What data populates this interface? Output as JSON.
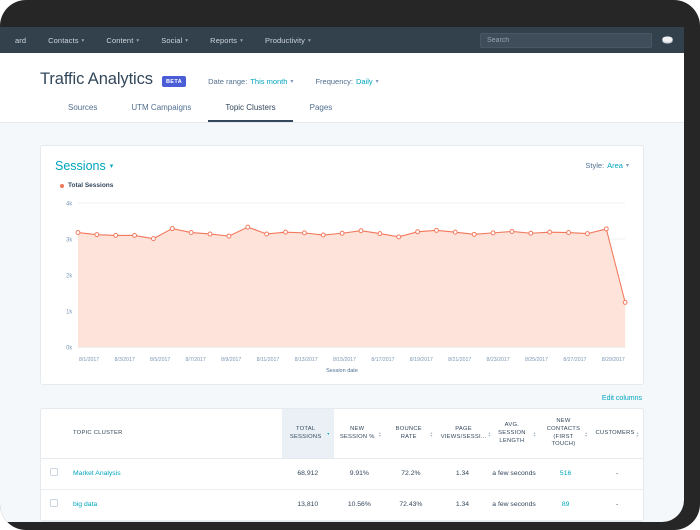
{
  "top_nav": {
    "items": [
      {
        "label": "ard",
        "caret": false
      },
      {
        "label": "Contacts",
        "caret": true
      },
      {
        "label": "Content",
        "caret": true
      },
      {
        "label": "Social",
        "caret": true
      },
      {
        "label": "Reports",
        "caret": true
      },
      {
        "label": "Productivity",
        "caret": true
      }
    ],
    "search_placeholder": "Search",
    "search_value": "",
    "sprocket_icon": "sprocket-icon",
    "background_color": "#33414d"
  },
  "header": {
    "title": "Traffic Analytics",
    "badge": "BETA",
    "badge_color": "#4a5dd7",
    "date_range_label": "Date range:",
    "date_range_value": "This month",
    "frequency_label": "Frequency:",
    "frequency_value": "Daily",
    "accent_color": "#00a4bd"
  },
  "tabs": [
    {
      "label": "Sources",
      "active": false
    },
    {
      "label": "UTM Campaigns",
      "active": false
    },
    {
      "label": "Topic Clusters",
      "active": true
    },
    {
      "label": "Pages",
      "active": false
    }
  ],
  "chart_card": {
    "title": "Sessions",
    "style_label": "Style:",
    "style_value": "Area",
    "legend_label": "Total Sessions",
    "legend_color": "#f2785c"
  },
  "chart_data": {
    "type": "area",
    "title": "Sessions",
    "xlabel": "Session date",
    "ylabel": "",
    "ylim": [
      0,
      4000
    ],
    "ytick_labels": [
      "0k",
      "1k",
      "2k",
      "3k",
      "4k"
    ],
    "ytick_values": [
      0,
      1000,
      2000,
      3000,
      4000
    ],
    "grid": true,
    "legend_position": "top-left",
    "series": [
      {
        "name": "Total Sessions",
        "color": "#f2785c",
        "fill_color": "#fde3da",
        "values": [
          3180,
          3120,
          3100,
          3100,
          3010,
          3290,
          3180,
          3140,
          3080,
          3330,
          3140,
          3190,
          3170,
          3110,
          3160,
          3230,
          3150,
          3060,
          3200,
          3240,
          3190,
          3130,
          3170,
          3210,
          3160,
          3190,
          3180,
          3150,
          3280,
          1240
        ]
      }
    ],
    "x": [
      "8/1/2017",
      "8/2/2017",
      "8/3/2017",
      "8/4/2017",
      "8/5/2017",
      "8/6/2017",
      "8/7/2017",
      "8/8/2017",
      "8/9/2017",
      "8/10/2017",
      "8/11/2017",
      "8/12/2017",
      "8/13/2017",
      "8/14/2017",
      "8/15/2017",
      "8/16/2017",
      "8/17/2017",
      "8/18/2017",
      "8/19/2017",
      "8/20/2017",
      "8/21/2017",
      "8/22/2017",
      "8/23/2017",
      "8/24/2017",
      "8/25/2017",
      "8/26/2017",
      "8/27/2017",
      "8/28/2017",
      "8/29/2017",
      "8/30/2017"
    ],
    "xtick_labels": [
      "8/1/2017",
      "8/3/2017",
      "8/5/2017",
      "8/7/2017",
      "8/9/2017",
      "8/11/2017",
      "8/13/2017",
      "8/15/2017",
      "8/17/2017",
      "8/19/2017",
      "8/21/2017",
      "8/23/2017",
      "8/25/2017",
      "8/27/2017",
      "8/29/2017"
    ]
  },
  "table": {
    "edit_columns_label": "Edit columns",
    "columns": [
      {
        "key": "check",
        "label": "",
        "sorted": false
      },
      {
        "key": "cluster",
        "label": "TOPIC CLUSTER",
        "sorted": false
      },
      {
        "key": "sessions",
        "label": "TOTAL SESSIONS",
        "sorted": true
      },
      {
        "key": "newpct",
        "label": "NEW SESSION %",
        "sorted": false
      },
      {
        "key": "bounce",
        "label": "BOUNCE RATE",
        "sorted": false
      },
      {
        "key": "views",
        "label": "PAGE VIEWS/SESSI...",
        "sorted": false
      },
      {
        "key": "length",
        "label": "AVG. SESSION LENGTH",
        "sorted": false
      },
      {
        "key": "contacts",
        "label": "NEW CONTACTS (FIRST TOUCH)",
        "sorted": false
      },
      {
        "key": "customers",
        "label": "CUSTOMERS",
        "sorted": false
      }
    ],
    "rows": [
      {
        "cluster": "Market Analysis",
        "sessions": "68,912",
        "newpct": "9.91%",
        "bounce": "72.2%",
        "views": "1.34",
        "length": "a few seconds",
        "contacts": "516",
        "customers": "-"
      },
      {
        "cluster": "big data",
        "sessions": "13,810",
        "newpct": "10.56%",
        "bounce": "72.43%",
        "views": "1.34",
        "length": "a few seconds",
        "contacts": "89",
        "customers": "-"
      }
    ]
  }
}
